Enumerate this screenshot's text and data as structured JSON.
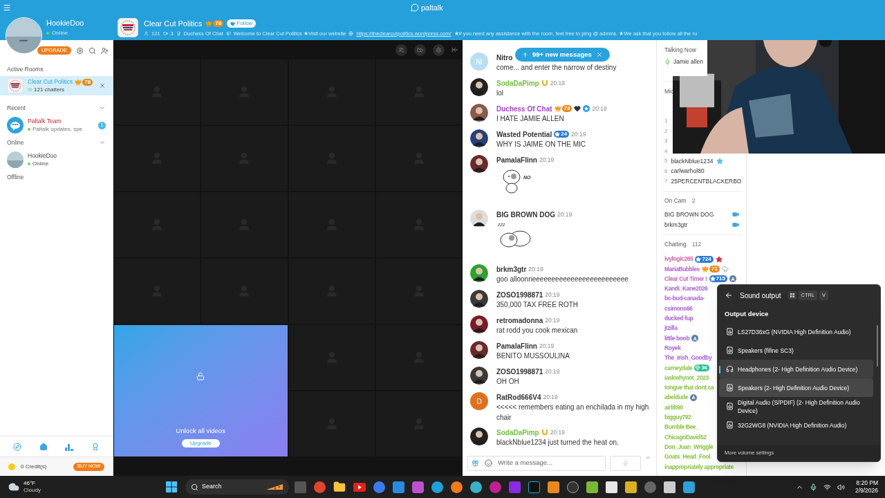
{
  "app": {
    "logo": "paltalk"
  },
  "profile": {
    "name": "HookieDoo",
    "status": "Online",
    "upgrade": "UPGRADE"
  },
  "room": {
    "title": "Clear Cut Politics",
    "crown": "78",
    "follow": "Follow",
    "members": "121",
    "cams": "3",
    "owner": "Duchess Of Chat",
    "welcome": "Welcome to Clear Cut Politics ★Visit our website ",
    "link": "https://theclearcutpolitics.wordpress.com/",
    "notice": "★If you need any assistance with the room, feel free to ping @ admins. ★We ask that you follow all the ru"
  },
  "sidebar": {
    "active_title": "Active Rooms",
    "active_room": {
      "title": "Clear Cut Politics",
      "crown": "78",
      "subtitle": "121 chatters",
      "selected": true
    },
    "sections": [
      {
        "title": "Recent",
        "expanded": true,
        "items": [
          {
            "kind": "team",
            "name": "Paltalk Team",
            "status": "Paltalk updates, spe",
            "unread": "1"
          }
        ]
      },
      {
        "title": "Online",
        "expanded": true,
        "items": [
          {
            "kind": "user",
            "name": "HookieDoo",
            "status": "Online"
          }
        ]
      },
      {
        "title": "Offline"
      }
    ],
    "credits": "0 Credit(s)",
    "buy": "BUY NOW"
  },
  "video": {
    "unlock": "Unlock all videos",
    "upgrade": "Upgrade"
  },
  "chat": {
    "new_messages": "99+ new messages",
    "placeholder": "Write a message...",
    "messages": [
      {
        "kind": "text",
        "avatar": {
          "kind": "letter",
          "text": "Ni",
          "color": "#b9dff0"
        },
        "name": "Nitro",
        "color": "#333333",
        "text": "come... and enter the narrow of destiny"
      },
      {
        "kind": "text",
        "avatar": {
          "kind": "picture",
          "color": "#222222"
        },
        "name": "SodaDaPimp",
        "color": "#6fbf3a",
        "badges": [
          {
            "kind": "horseshoe"
          }
        ],
        "time": "20:19",
        "text": "lol"
      },
      {
        "kind": "text",
        "avatar": {
          "kind": "picture",
          "color": "#8a5a4a"
        },
        "name": "Duchess Of Chat",
        "color": "#a53fd0",
        "badges": [
          {
            "kind": "crown",
            "text": "73"
          },
          {
            "kind": "heart"
          },
          {
            "kind": "starcircle"
          }
        ],
        "time": "20:19",
        "text": "I HATE JAMIE ALLEN"
      },
      {
        "kind": "text",
        "avatar": {
          "kind": "picture",
          "color": "#2b3f7a"
        },
        "name": "Wasted Potential",
        "color": "#333333",
        "badges": [
          {
            "kind": "star",
            "text": "24"
          }
        ],
        "time": "20:19",
        "text": "WHY IS JAIME ON THE MIC"
      },
      {
        "kind": "puppy_sticker",
        "avatar": {
          "kind": "picture",
          "color": "#6a2a2a"
        },
        "name": "PamalaFlinn",
        "color": "#333333",
        "time": "20:19",
        "text": "NO"
      },
      {
        "kind": "sleeping_puppy_sticker",
        "avatar": {
          "kind": "picture",
          "color": "#dddddd"
        },
        "name": "BIG BROWN DOG",
        "color": "#333333",
        "time": "20:19",
        "text": "zzz"
      },
      {
        "kind": "text",
        "avatar": {
          "kind": "picture",
          "color": "#2fa22f"
        },
        "name": "brkm3gtr",
        "color": "#333333",
        "time": "20:19",
        "text": "goo alloonneeeeeeeeeeeeeeeeeeeeeeeee"
      },
      {
        "kind": "text",
        "avatar": {
          "kind": "picture",
          "color": "#3a3a3a"
        },
        "name": "ZOSO1998871",
        "color": "#333333",
        "time": "20:19",
        "text": "350,000 TAX FREE ROTH"
      },
      {
        "kind": "text",
        "avatar": {
          "kind": "picture",
          "color": "#7a1a2a"
        },
        "name": "retromadonna",
        "color": "#333333",
        "time": "20:19",
        "text": "rat rodd you cook mexican"
      },
      {
        "kind": "text",
        "avatar": {
          "kind": "picture",
          "color": "#6a2a2a"
        },
        "name": "PamalaFlinn",
        "color": "#333333",
        "time": "20:19",
        "text": "BENITO MUSSOULINA"
      },
      {
        "kind": "text",
        "avatar": {
          "kind": "picture",
          "color": "#3a3a3a"
        },
        "name": "ZOSO1998871",
        "color": "#333333",
        "time": "20:19",
        "text": "OH OH"
      },
      {
        "kind": "text",
        "avatar": {
          "kind": "letter",
          "text": "D",
          "color": "#e0701e"
        },
        "name": "RatRod666V4",
        "color": "#333333",
        "time": "20:19",
        "text": "<<<<< remembers eating an enchilada in my high chair"
      },
      {
        "kind": "text",
        "avatar": {
          "kind": "picture",
          "color": "#222222"
        },
        "name": "SodaDaPimp",
        "color": "#6fbf3a",
        "badges": [
          {
            "kind": "horseshoe"
          }
        ],
        "time": "20:19",
        "text": "blackNblue1234 just turned the heat on."
      }
    ]
  },
  "users": {
    "talking_title": "Talking Now",
    "talking": [
      {
        "name": "Jamie allen"
      }
    ],
    "queue_title": "Mic",
    "queue": [
      {
        "number": "1"
      },
      {
        "number": "2"
      },
      {
        "number": "3"
      },
      {
        "number": "4"
      },
      {
        "number": "5",
        "name": "blackNblue1234",
        "badges": [
          {
            "kind": "starplain"
          }
        ]
      },
      {
        "number": "6",
        "name": "carlwarhol80"
      },
      {
        "number": "7",
        "name": "25PERCENTBLACKERBO"
      }
    ],
    "cam_title": "On Cam",
    "cam_count": "2",
    "cams": [
      {
        "name": "BIG BROWN DOG"
      },
      {
        "name": "brkm3gtr"
      }
    ],
    "chatting_title": "Chatting",
    "chatting_count": "112",
    "chatting": [
      {
        "name": "ivylogic265",
        "color": "#d45fa4",
        "badges": [
          {
            "kind": "star",
            "text": "724"
          },
          {
            "kind": "redstar"
          }
        ]
      },
      {
        "name": "MariaBubbles",
        "color": "#b35bd6",
        "badges": [
          {
            "kind": "crown",
            "text": "71"
          },
          {
            "kind": "cloud"
          }
        ]
      },
      {
        "name": "Clear Cut Timer !",
        "color": "#c75fc0",
        "badges": [
          {
            "kind": "star",
            "text": "715"
          },
          {
            "kind": "admin",
            "text": "A"
          }
        ]
      },
      {
        "name": "Kandi_Kane2026",
        "color": "#a95ed3"
      },
      {
        "name": "bc-bud-canada-",
        "color": "#a95ed3"
      },
      {
        "name": "csimons66",
        "color": "#a95ed3"
      },
      {
        "name": "ducked fup",
        "color": "#a95ed3"
      },
      {
        "name": "jtzilla",
        "color": "#a95ed3"
      },
      {
        "name": "little boob",
        "color": "#a95ed3",
        "badges": [
          {
            "kind": "admin",
            "text": "A"
          }
        ]
      },
      {
        "name": "Royek",
        "color": "#a95ed3"
      },
      {
        "name": "The_Irish_Goodby",
        "color": "#a95ed3"
      },
      {
        "name": "carneydale",
        "color": "#86c23f",
        "badges": [
          {
            "kind": "diamond",
            "text": "36"
          }
        ]
      },
      {
        "name": "iaskwhynot_2023",
        "color": "#86c23f"
      },
      {
        "name": "tongue that dont ca",
        "color": "#86c23f"
      },
      {
        "name": "abeldude",
        "color": "#86c23f",
        "badges": [
          {
            "kind": "admin",
            "text": "A"
          }
        ]
      },
      {
        "name": "airlift90",
        "color": "#86c23f"
      },
      {
        "name": "bigguy792",
        "color": "#86c23f"
      },
      {
        "name": "Bumble Bee_",
        "color": "#86c23f"
      },
      {
        "name": "ChicagoDavid52",
        "color": "#86c23f"
      },
      {
        "name": "Don_Juan_Wriggle",
        "color": "#86c23f"
      },
      {
        "name": "Goats_Head_Fool",
        "color": "#86c23f"
      },
      {
        "name": "inappropriately appropriate",
        "color": "#86c23f"
      }
    ]
  },
  "sound": {
    "title": "Sound output",
    "keys": [
      "CTRL",
      "V"
    ],
    "heading": "Output device",
    "footer": "More volume settings",
    "devices": [
      {
        "kind": "speaker",
        "name": "LS27D36xG (NVIDIA High Definition Audio)",
        "selected": false,
        "hovered": false
      },
      {
        "kind": "speaker",
        "name": "Speakers (fifine SC3)",
        "selected": false,
        "hovered": false
      },
      {
        "kind": "headphones",
        "name": "Headphones (2- High Definition Audio Device)",
        "selected": true,
        "hovered": false
      },
      {
        "kind": "speaker",
        "name": "Speakers (2- High Definition Audio Device)",
        "selected": false,
        "hovered": true
      },
      {
        "kind": "speaker",
        "name": "Digital Audio (S/PDIF) (2- High Definition Audio Device)",
        "selected": false,
        "hovered": false
      },
      {
        "kind": "speaker",
        "name": "32G2WG8 (NVIDIA High Definition Audio)",
        "selected": false,
        "hovered": false
      }
    ]
  },
  "taskbar": {
    "temp": "46°F",
    "condition": "Cloudy",
    "search": "Search",
    "time": "8:20 PM",
    "date": "2/9/2026"
  }
}
